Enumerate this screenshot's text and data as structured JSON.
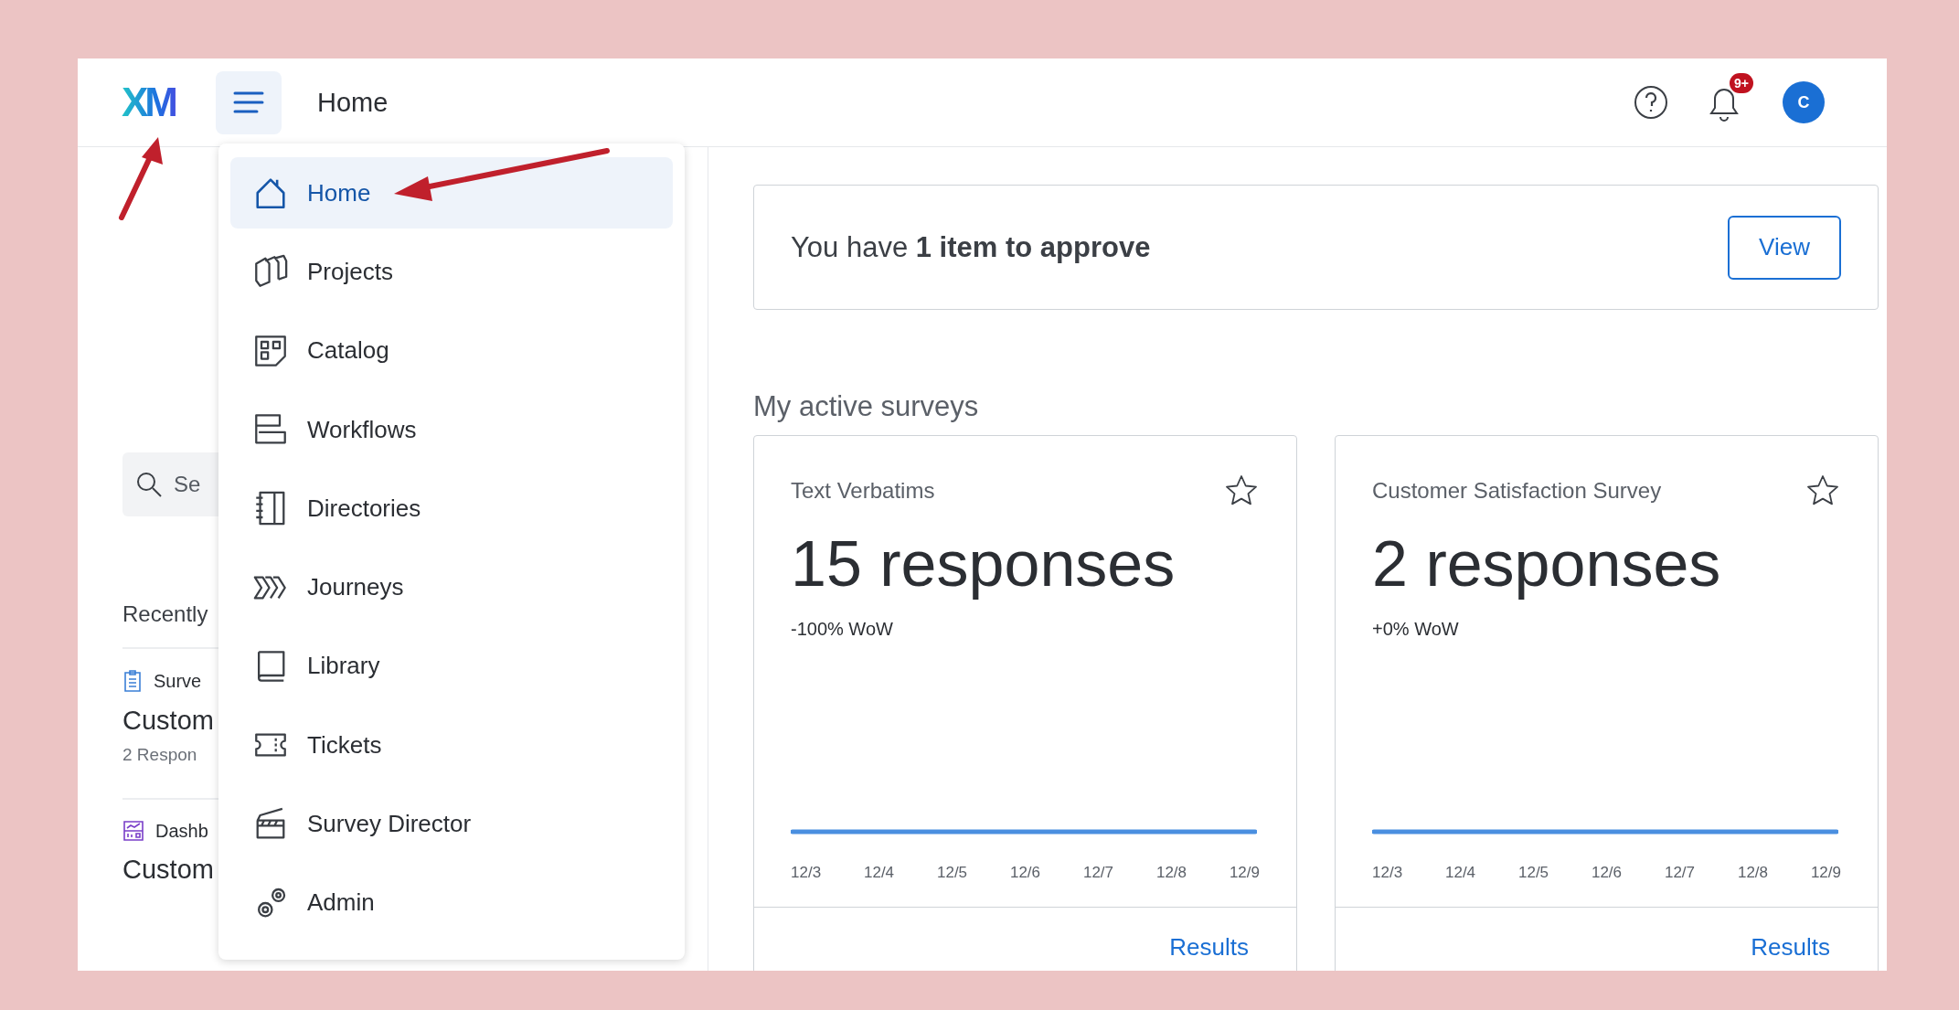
{
  "header": {
    "logo": "XM",
    "title": "Home",
    "notifications_badge": "9+",
    "avatar": "C"
  },
  "nav_menu": {
    "items": [
      {
        "label": "Home",
        "selected": true
      },
      {
        "label": "Projects",
        "selected": false
      },
      {
        "label": "Catalog",
        "selected": false
      },
      {
        "label": "Workflows",
        "selected": false
      },
      {
        "label": "Directories",
        "selected": false
      },
      {
        "label": "Journeys",
        "selected": false
      },
      {
        "label": "Library",
        "selected": false
      },
      {
        "label": "Tickets",
        "selected": false
      },
      {
        "label": "Survey Director",
        "selected": false
      },
      {
        "label": "Admin",
        "selected": false
      }
    ]
  },
  "sidebar": {
    "search": {
      "placeholder": "Se"
    },
    "recent_heading": "Recently",
    "recent_items": [
      {
        "kind": "survey",
        "type_label": "Surve",
        "name": "Custom",
        "detail": "2 Respon"
      },
      {
        "kind": "dashboard",
        "type_label": "Dashb",
        "name": "Custom"
      }
    ]
  },
  "approval": {
    "text": "You have **1 item to approve**",
    "button": "View"
  },
  "surveys_heading": "My active surveys",
  "survey_cards": [
    {
      "title": "Text Verbatims",
      "starred": false,
      "responses": "15 responses",
      "change": "-100% WoW",
      "x_labels": [
        "12/3",
        "12/4",
        "12/5",
        "12/6",
        "12/7",
        "12/8",
        "12/9"
      ],
      "link": "Results"
    },
    {
      "title": "Customer Satisfaction Survey",
      "starred": false,
      "responses": "2 responses",
      "change": "+0% WoW",
      "x_labels": [
        "12/3",
        "12/4",
        "12/5",
        "12/6",
        "12/7",
        "12/8",
        "12/9"
      ],
      "link": "Results"
    }
  ]
}
